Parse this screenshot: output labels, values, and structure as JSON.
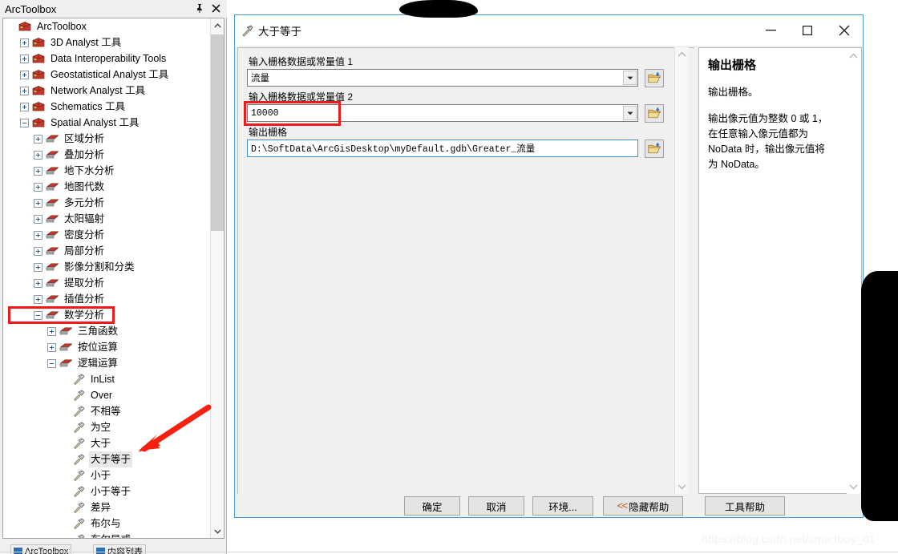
{
  "toolbox_panel": {
    "title": "ArcToolbox",
    "pin_icon": "pin-icon",
    "close_icon": "close-icon",
    "tree": [
      {
        "depth": 0,
        "label": "ArcToolbox",
        "icon": "toolbox-icon",
        "expander": "none",
        "selected": false
      },
      {
        "depth": 1,
        "label": "3D Analyst 工具",
        "icon": "toolbox-icon",
        "expander": "plus",
        "selected": false
      },
      {
        "depth": 1,
        "label": "Data Interoperability Tools",
        "icon": "toolbox-icon",
        "expander": "plus",
        "selected": false
      },
      {
        "depth": 1,
        "label": "Geostatistical Analyst 工具",
        "icon": "toolbox-icon",
        "expander": "plus",
        "selected": false
      },
      {
        "depth": 1,
        "label": "Network Analyst 工具",
        "icon": "toolbox-icon",
        "expander": "plus",
        "selected": false
      },
      {
        "depth": 1,
        "label": "Schematics 工具",
        "icon": "toolbox-icon",
        "expander": "plus",
        "selected": false
      },
      {
        "depth": 1,
        "label": "Spatial Analyst 工具",
        "icon": "toolbox-icon",
        "expander": "minus",
        "selected": false
      },
      {
        "depth": 2,
        "label": "区域分析",
        "icon": "toolset-icon",
        "expander": "plus",
        "selected": false
      },
      {
        "depth": 2,
        "label": "叠加分析",
        "icon": "toolset-icon",
        "expander": "plus",
        "selected": false
      },
      {
        "depth": 2,
        "label": "地下水分析",
        "icon": "toolset-icon",
        "expander": "plus",
        "selected": false
      },
      {
        "depth": 2,
        "label": "地图代数",
        "icon": "toolset-icon",
        "expander": "plus",
        "selected": false
      },
      {
        "depth": 2,
        "label": "多元分析",
        "icon": "toolset-icon",
        "expander": "plus",
        "selected": false
      },
      {
        "depth": 2,
        "label": "太阳辐射",
        "icon": "toolset-icon",
        "expander": "plus",
        "selected": false
      },
      {
        "depth": 2,
        "label": "密度分析",
        "icon": "toolset-icon",
        "expander": "plus",
        "selected": false
      },
      {
        "depth": 2,
        "label": "局部分析",
        "icon": "toolset-icon",
        "expander": "plus",
        "selected": false
      },
      {
        "depth": 2,
        "label": "影像分割和分类",
        "icon": "toolset-icon",
        "expander": "plus",
        "selected": false
      },
      {
        "depth": 2,
        "label": "提取分析",
        "icon": "toolset-icon",
        "expander": "plus",
        "selected": false
      },
      {
        "depth": 2,
        "label": "插值分析",
        "icon": "toolset-icon",
        "expander": "plus",
        "selected": false
      },
      {
        "depth": 2,
        "label": "数学分析",
        "icon": "toolset-icon",
        "expander": "minus",
        "selected": false,
        "highlight": "red-box"
      },
      {
        "depth": 3,
        "label": "三角函数",
        "icon": "toolset-icon",
        "expander": "plus",
        "selected": false
      },
      {
        "depth": 3,
        "label": "按位运算",
        "icon": "toolset-icon",
        "expander": "plus",
        "selected": false
      },
      {
        "depth": 3,
        "label": "逻辑运算",
        "icon": "toolset-icon",
        "expander": "minus",
        "selected": false
      },
      {
        "depth": 4,
        "label": "InList",
        "icon": "tool-hammer-icon",
        "expander": "none",
        "selected": false
      },
      {
        "depth": 4,
        "label": "Over",
        "icon": "tool-hammer-icon",
        "expander": "none",
        "selected": false
      },
      {
        "depth": 4,
        "label": "不相等",
        "icon": "tool-hammer-icon",
        "expander": "none",
        "selected": false
      },
      {
        "depth": 4,
        "label": "为空",
        "icon": "tool-hammer-icon",
        "expander": "none",
        "selected": false
      },
      {
        "depth": 4,
        "label": "大于",
        "icon": "tool-hammer-icon",
        "expander": "none",
        "selected": false
      },
      {
        "depth": 4,
        "label": "大于等于",
        "icon": "tool-hammer-icon",
        "expander": "none",
        "selected": true
      },
      {
        "depth": 4,
        "label": "小于",
        "icon": "tool-hammer-icon",
        "expander": "none",
        "selected": false
      },
      {
        "depth": 4,
        "label": "小于等于",
        "icon": "tool-hammer-icon",
        "expander": "none",
        "selected": false
      },
      {
        "depth": 4,
        "label": "差异",
        "icon": "tool-hammer-icon",
        "expander": "none",
        "selected": false
      },
      {
        "depth": 4,
        "label": "布尔与",
        "icon": "tool-hammer-icon",
        "expander": "none",
        "selected": false
      },
      {
        "depth": 4,
        "label": "布尔异或",
        "icon": "tool-hammer-icon",
        "expander": "none",
        "selected": false
      }
    ],
    "bottom_tabs": [
      {
        "label": "ArcToolbox"
      },
      {
        "label": "内容列表"
      }
    ]
  },
  "dialog": {
    "title": "大于等于",
    "title_icon": "tool-hammer-icon",
    "minimize_label": "–",
    "maximize_label": "□",
    "close_label": "✕",
    "fields": [
      {
        "label": "输入栅格数据或常量值 1",
        "value": "流量",
        "type": "combobox",
        "browse_icon": "open-folder-icon",
        "highlighted": false
      },
      {
        "label": "输入栅格数据或常量值 2",
        "value": "10000",
        "type": "combobox",
        "browse_icon": "open-folder-icon",
        "highlighted": true
      },
      {
        "label": "输出栅格",
        "value": "D:\\SoftData\\ArcGisDesktop\\myDefault.gdb\\Greater_流量",
        "type": "textbox",
        "browse_icon": "open-folder-icon",
        "highlighted": false
      }
    ],
    "help": {
      "title": "输出栅格",
      "paragraphs": [
        "输出栅格。",
        "输出像元值为整数 0 或 1，在任意输入像元值都为 NoData 时，输出像元值将为 NoData。"
      ]
    },
    "buttons": [
      {
        "label": "确定",
        "name": "ok-button",
        "prefix": ""
      },
      {
        "label": "取消",
        "name": "cancel-button",
        "prefix": ""
      },
      {
        "label": "环境...",
        "name": "environments-button",
        "prefix": ""
      },
      {
        "label": "隐藏帮助",
        "name": "hide-help-button",
        "prefix": "<<"
      },
      {
        "label": "工具帮助",
        "name": "tool-help-button",
        "prefix": ""
      }
    ]
  },
  "annotations": {
    "red_arrow": "red-arrow-pointing-to-greater-equal-tool",
    "red_box_toolset": "数学分析",
    "red_box_field": "10000",
    "watermark": "https://blog.csdn.net/smartboy_01",
    "accent_red": "#ef1b1b",
    "accent_blue": "#4a9ad4",
    "chevron_orange": "#c05a10"
  }
}
